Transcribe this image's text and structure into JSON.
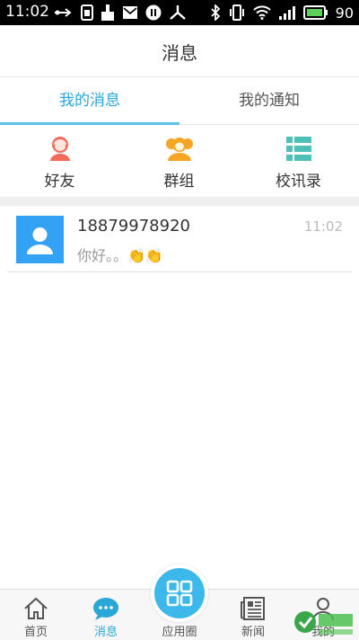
{
  "status_bar": {
    "time": "11:02",
    "battery": "90",
    "icons_left": [
      "usb-icon",
      "sim-icon",
      "clean-icon",
      "mail-icon",
      "pause-icon",
      "share-icon"
    ],
    "icons_right": [
      "bluetooth-icon",
      "vibrate-icon",
      "wifi-icon",
      "signal-icon",
      "battery-icon"
    ]
  },
  "header": {
    "title": "消息"
  },
  "tabs": [
    {
      "label": "我的消息",
      "active": true
    },
    {
      "label": "我的通知",
      "active": false
    }
  ],
  "quick_entries": [
    {
      "label": "好友",
      "icon": "friend-icon",
      "color": "#f26b5b"
    },
    {
      "label": "群组",
      "icon": "group-icon",
      "color": "#f5a623"
    },
    {
      "label": "校讯录",
      "icon": "directory-icon",
      "color": "#4fc0b8"
    }
  ],
  "conversations": [
    {
      "name": "18879978920",
      "time": "11:02",
      "message": "你好。。👏👏"
    }
  ],
  "bottom_nav": [
    {
      "label": "首页",
      "icon": "home-icon",
      "active": false
    },
    {
      "label": "消息",
      "icon": "chat-icon",
      "active": true
    },
    {
      "label": "应用圈",
      "icon": "apps-icon",
      "active": false
    },
    {
      "label": "新闻",
      "icon": "news-icon",
      "active": false
    },
    {
      "label": "我的",
      "icon": "profile-icon",
      "active": false
    }
  ],
  "colors": {
    "accent": "#2aa7d6",
    "avatar": "#33a2f4",
    "center_button": "#3cb9ea"
  }
}
